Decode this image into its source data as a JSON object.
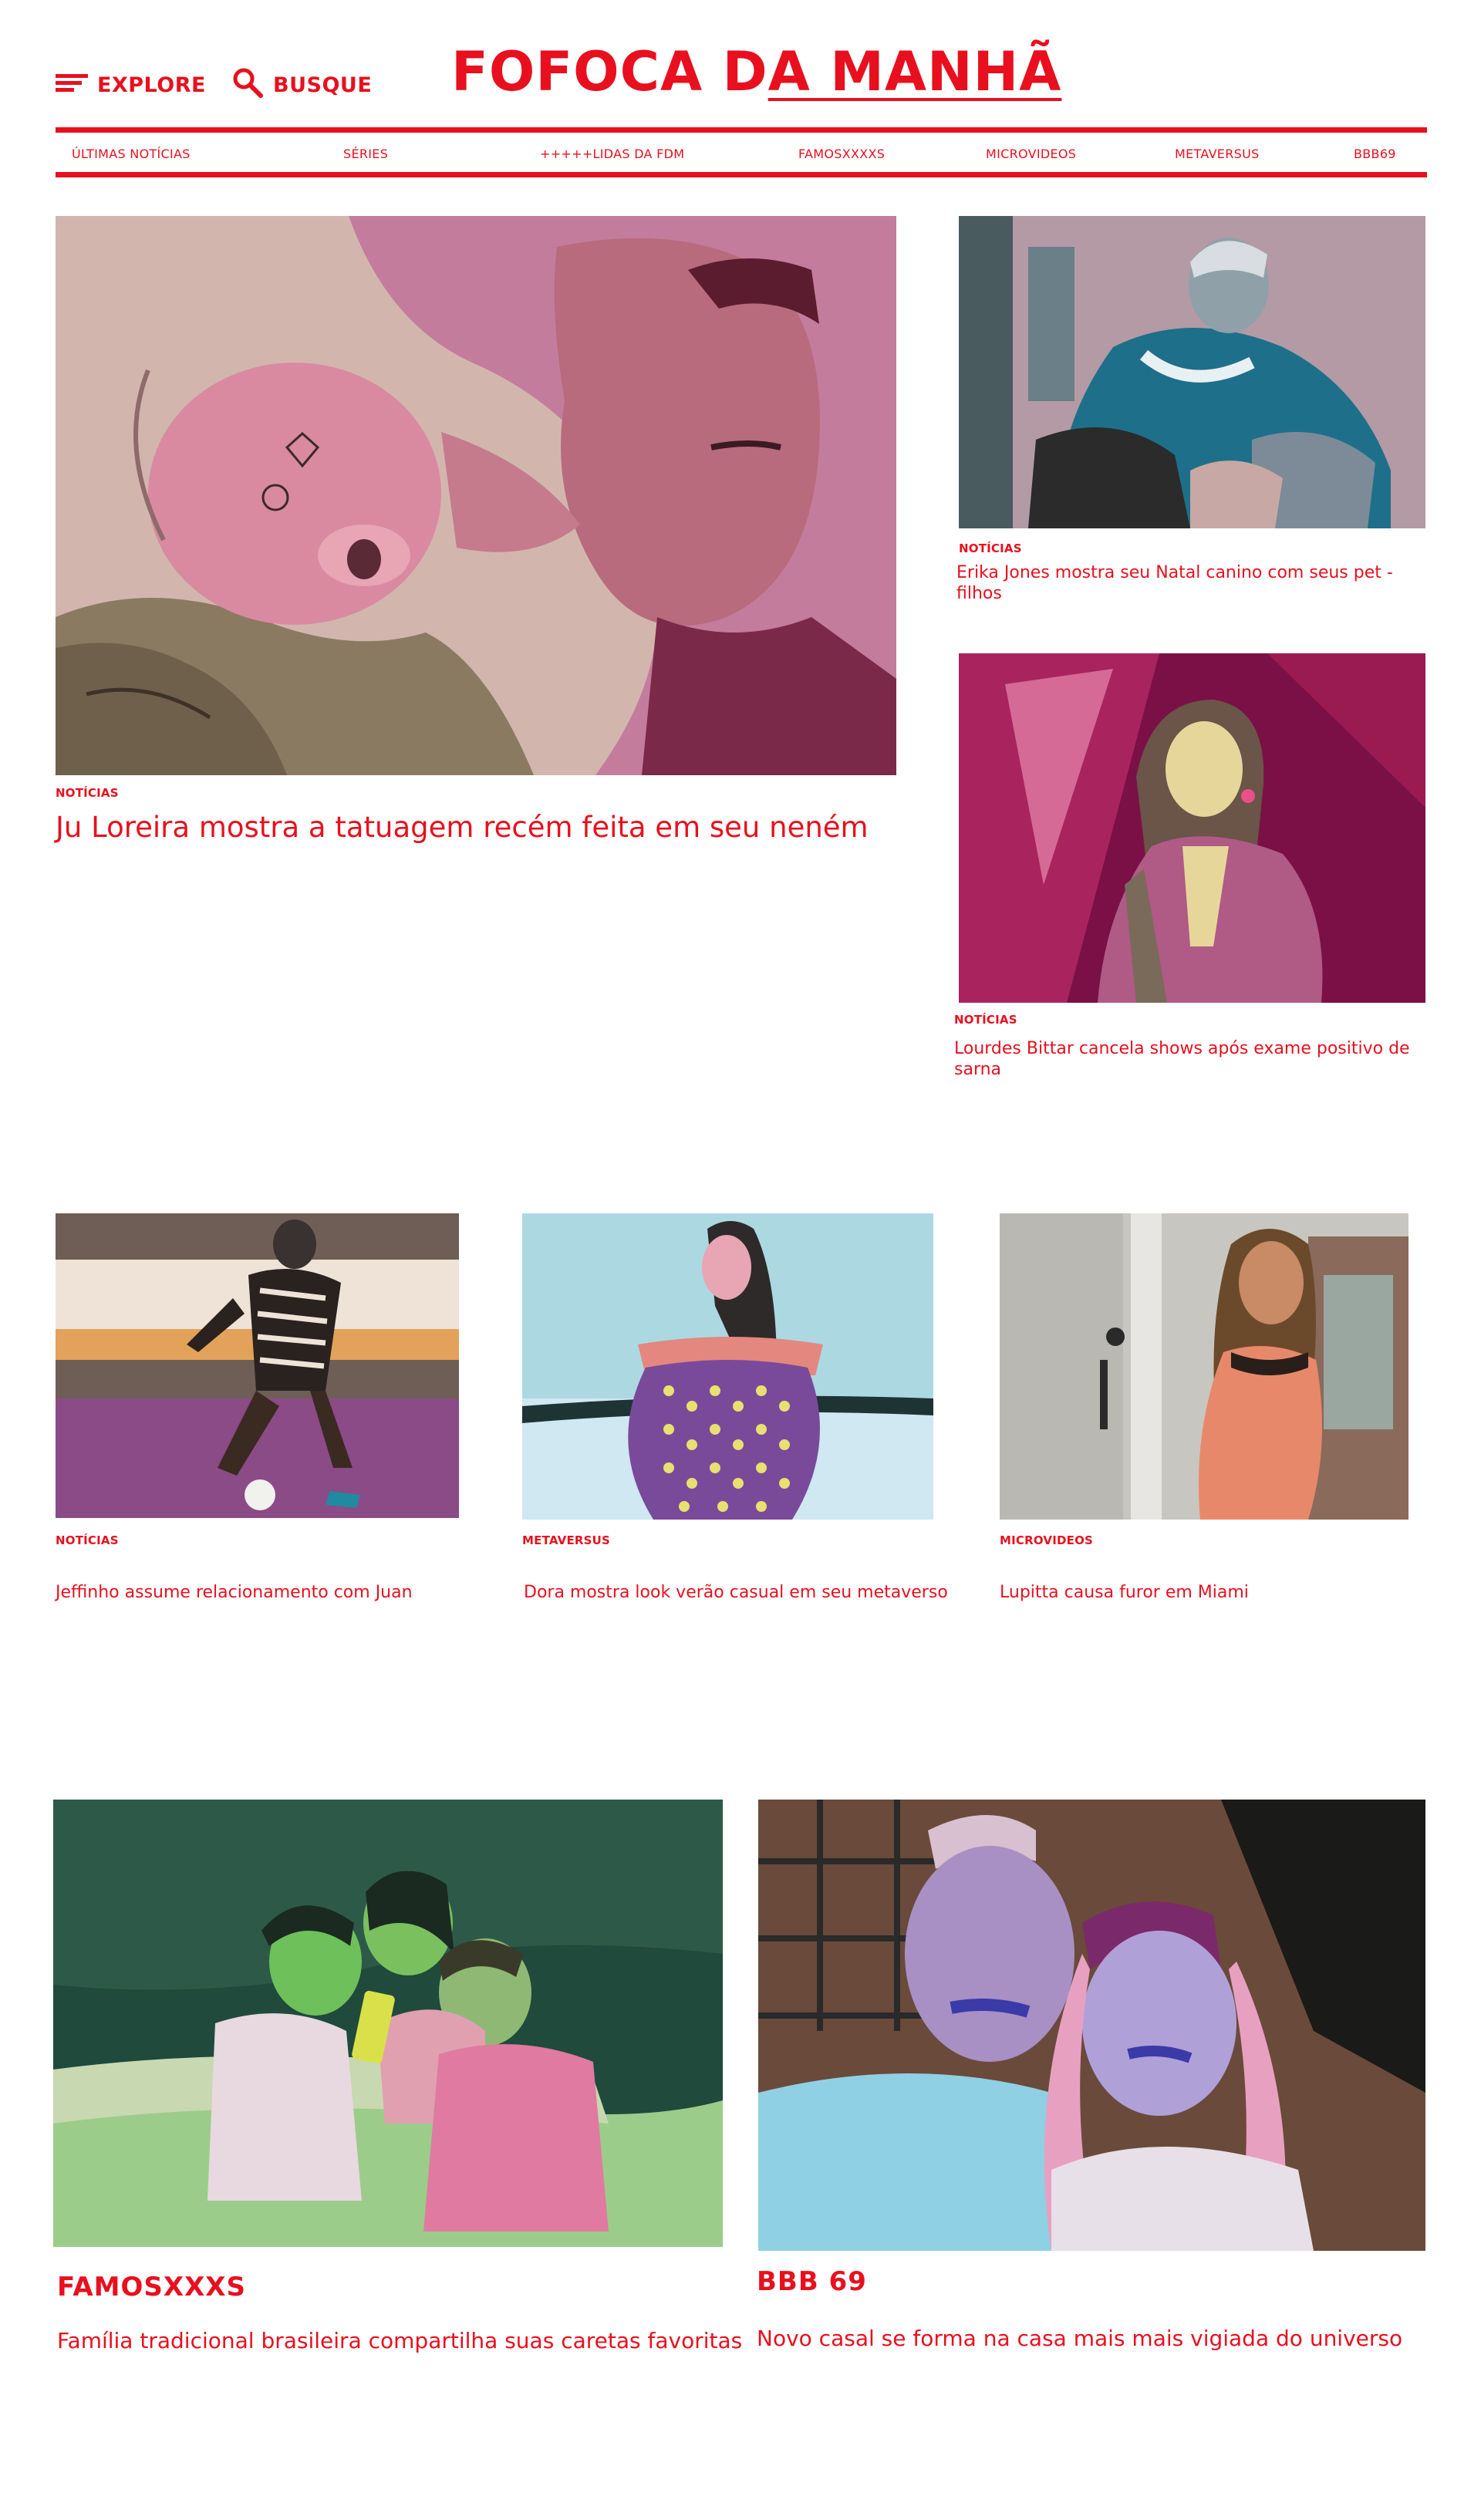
{
  "header": {
    "explore_label": "EXPLORE",
    "search_label": "BUSQUE",
    "logo_part1": "FOFOCA D",
    "logo_part2": "A MANHÃ"
  },
  "nav": {
    "items": [
      "ÚLTIMAS NOTÍCIAS",
      "SÉRIES",
      "+++++LIDAS DA FDM",
      "FAMOSXXXXS",
      "MICROVIDEOS",
      "METAVERSUS",
      "BBB69"
    ]
  },
  "colors": {
    "brand_red": "#e8101e"
  },
  "articles": {
    "hero": {
      "category": "NOTÍCIAS",
      "title": "Ju Loreira mostra a tatuagem recém feita em seu neném"
    },
    "side1": {
      "category": "NOTÍCIAS",
      "title": "Erika Jones mostra seu Natal canino com seus pet -filhos"
    },
    "side2": {
      "category": "NOTÍCIAS",
      "title": "Lourdes Bittar cancela shows após exame positivo de sarna"
    },
    "row1": {
      "category": "NOTÍCIAS",
      "title": "Jeffinho assume relacionamento com Juan"
    },
    "row2": {
      "category": "METAVERSUS",
      "title": "Dora mostra look verão casual em seu metaverso"
    },
    "row3": {
      "category": "MICROVIDEOS",
      "title": "Lupitta causa furor em Miami"
    },
    "big1": {
      "category": "FAMOSXXXS",
      "title": "Família tradicional brasileira compartilha suas caretas favoritas"
    },
    "big2": {
      "category": "BBB 69",
      "title": "Novo casal se forma na casa mais mais vigiada do universo"
    }
  }
}
